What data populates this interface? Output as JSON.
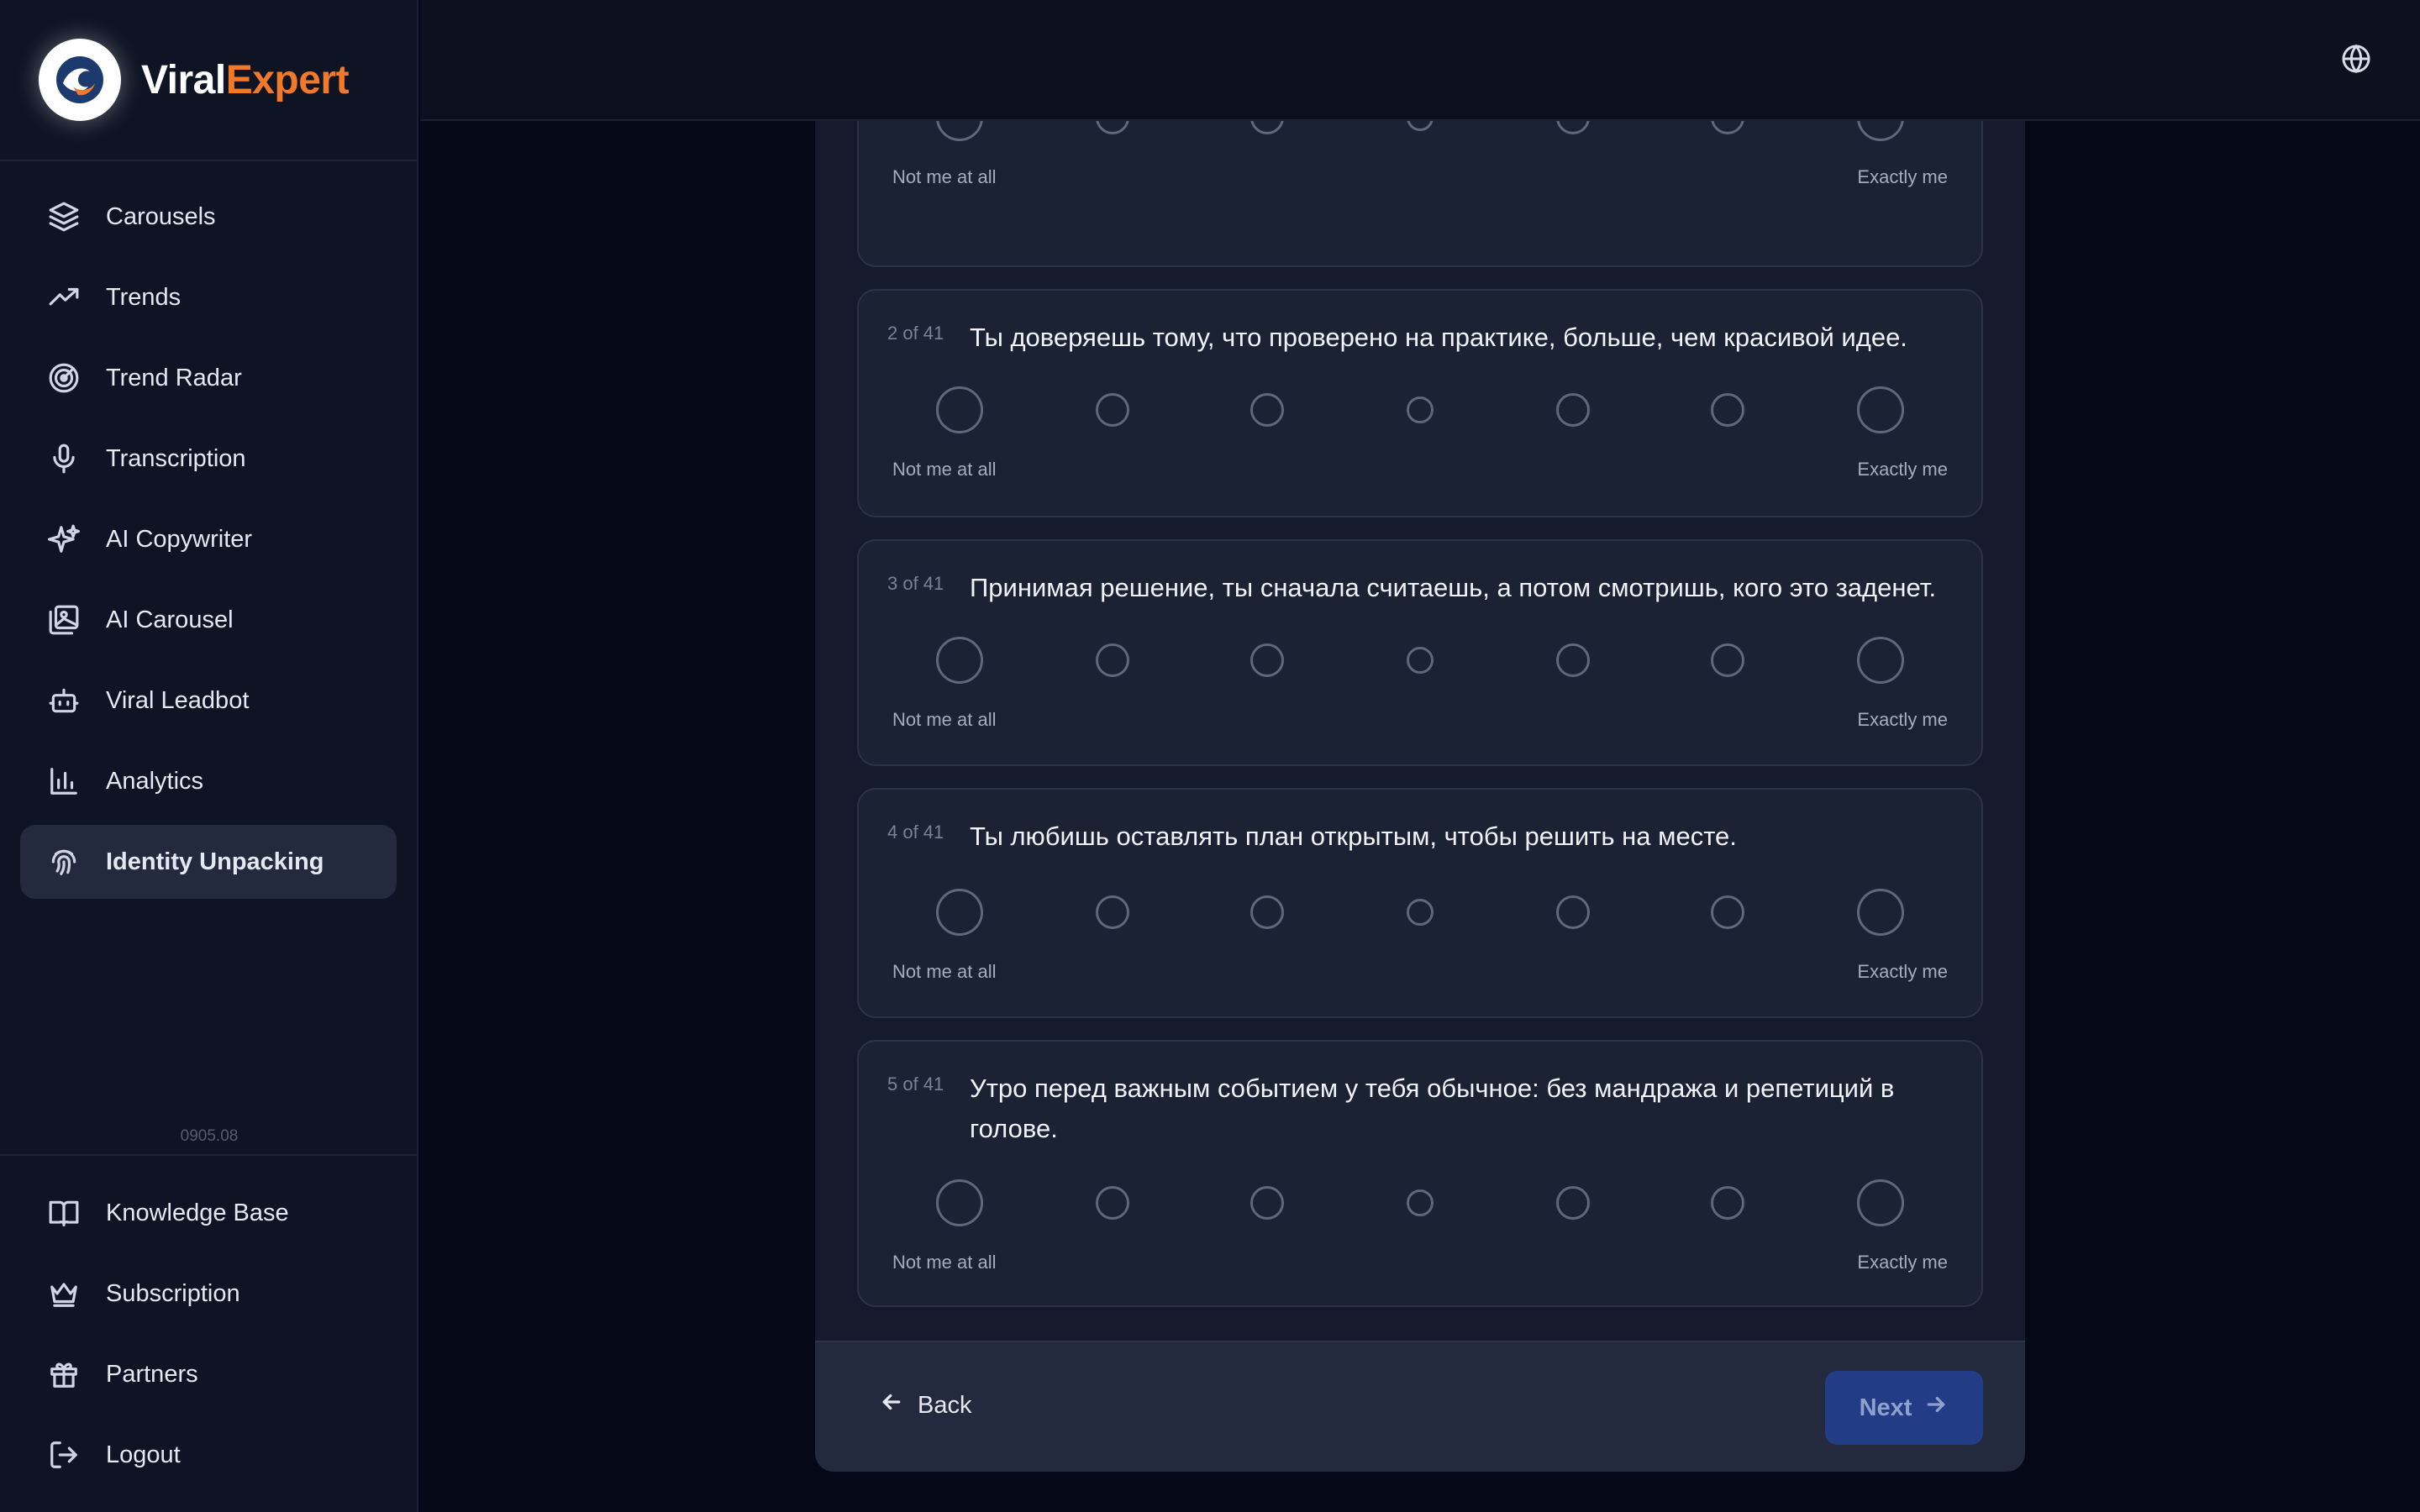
{
  "brand": {
    "part1": "Viral",
    "part2": "Expert",
    "accent_color": "#f07a2a"
  },
  "sidebar": {
    "items": [
      {
        "label": "Carousels",
        "icon": "layers-icon"
      },
      {
        "label": "Trends",
        "icon": "trending-up-icon"
      },
      {
        "label": "Trend Radar",
        "icon": "radar-icon"
      },
      {
        "label": "Transcription",
        "icon": "microphone-icon"
      },
      {
        "label": "AI Copywriter",
        "icon": "sparkles-icon"
      },
      {
        "label": "AI Carousel",
        "icon": "images-icon"
      },
      {
        "label": "Viral Leadbot",
        "icon": "bot-icon"
      },
      {
        "label": "Analytics",
        "icon": "bar-chart-icon"
      },
      {
        "label": "Identity Unpacking",
        "icon": "fingerprint-icon",
        "active": true
      }
    ],
    "version": "0905.08",
    "bottom_items": [
      {
        "label": "Knowledge Base",
        "icon": "book-icon"
      },
      {
        "label": "Subscription",
        "icon": "crown-icon"
      },
      {
        "label": "Partners",
        "icon": "gift-icon"
      },
      {
        "label": "Logout",
        "icon": "logout-icon"
      }
    ]
  },
  "topbar": {
    "language_icon": "globe-icon"
  },
  "scale_labels": {
    "left": "Not me at all",
    "right": "Exactly me"
  },
  "questions": [
    {
      "number": "",
      "text": ""
    },
    {
      "number": "2 of 41",
      "text": "Ты доверяешь тому, что проверено на практике, больше, чем красивой идее."
    },
    {
      "number": "3 of 41",
      "text": "Принимая решение, ты сначала считаешь, а потом смотришь, кого это заденет."
    },
    {
      "number": "4 of 41",
      "text": "Ты любишь оставлять план открытым, чтобы решить на месте."
    },
    {
      "number": "5 of 41",
      "text": "Утро перед важным событием у тебя обычное: без мандража и репетиций в голове."
    }
  ],
  "footer": {
    "back_label": "Back",
    "next_label": "Next",
    "next_color": "#223c85"
  }
}
